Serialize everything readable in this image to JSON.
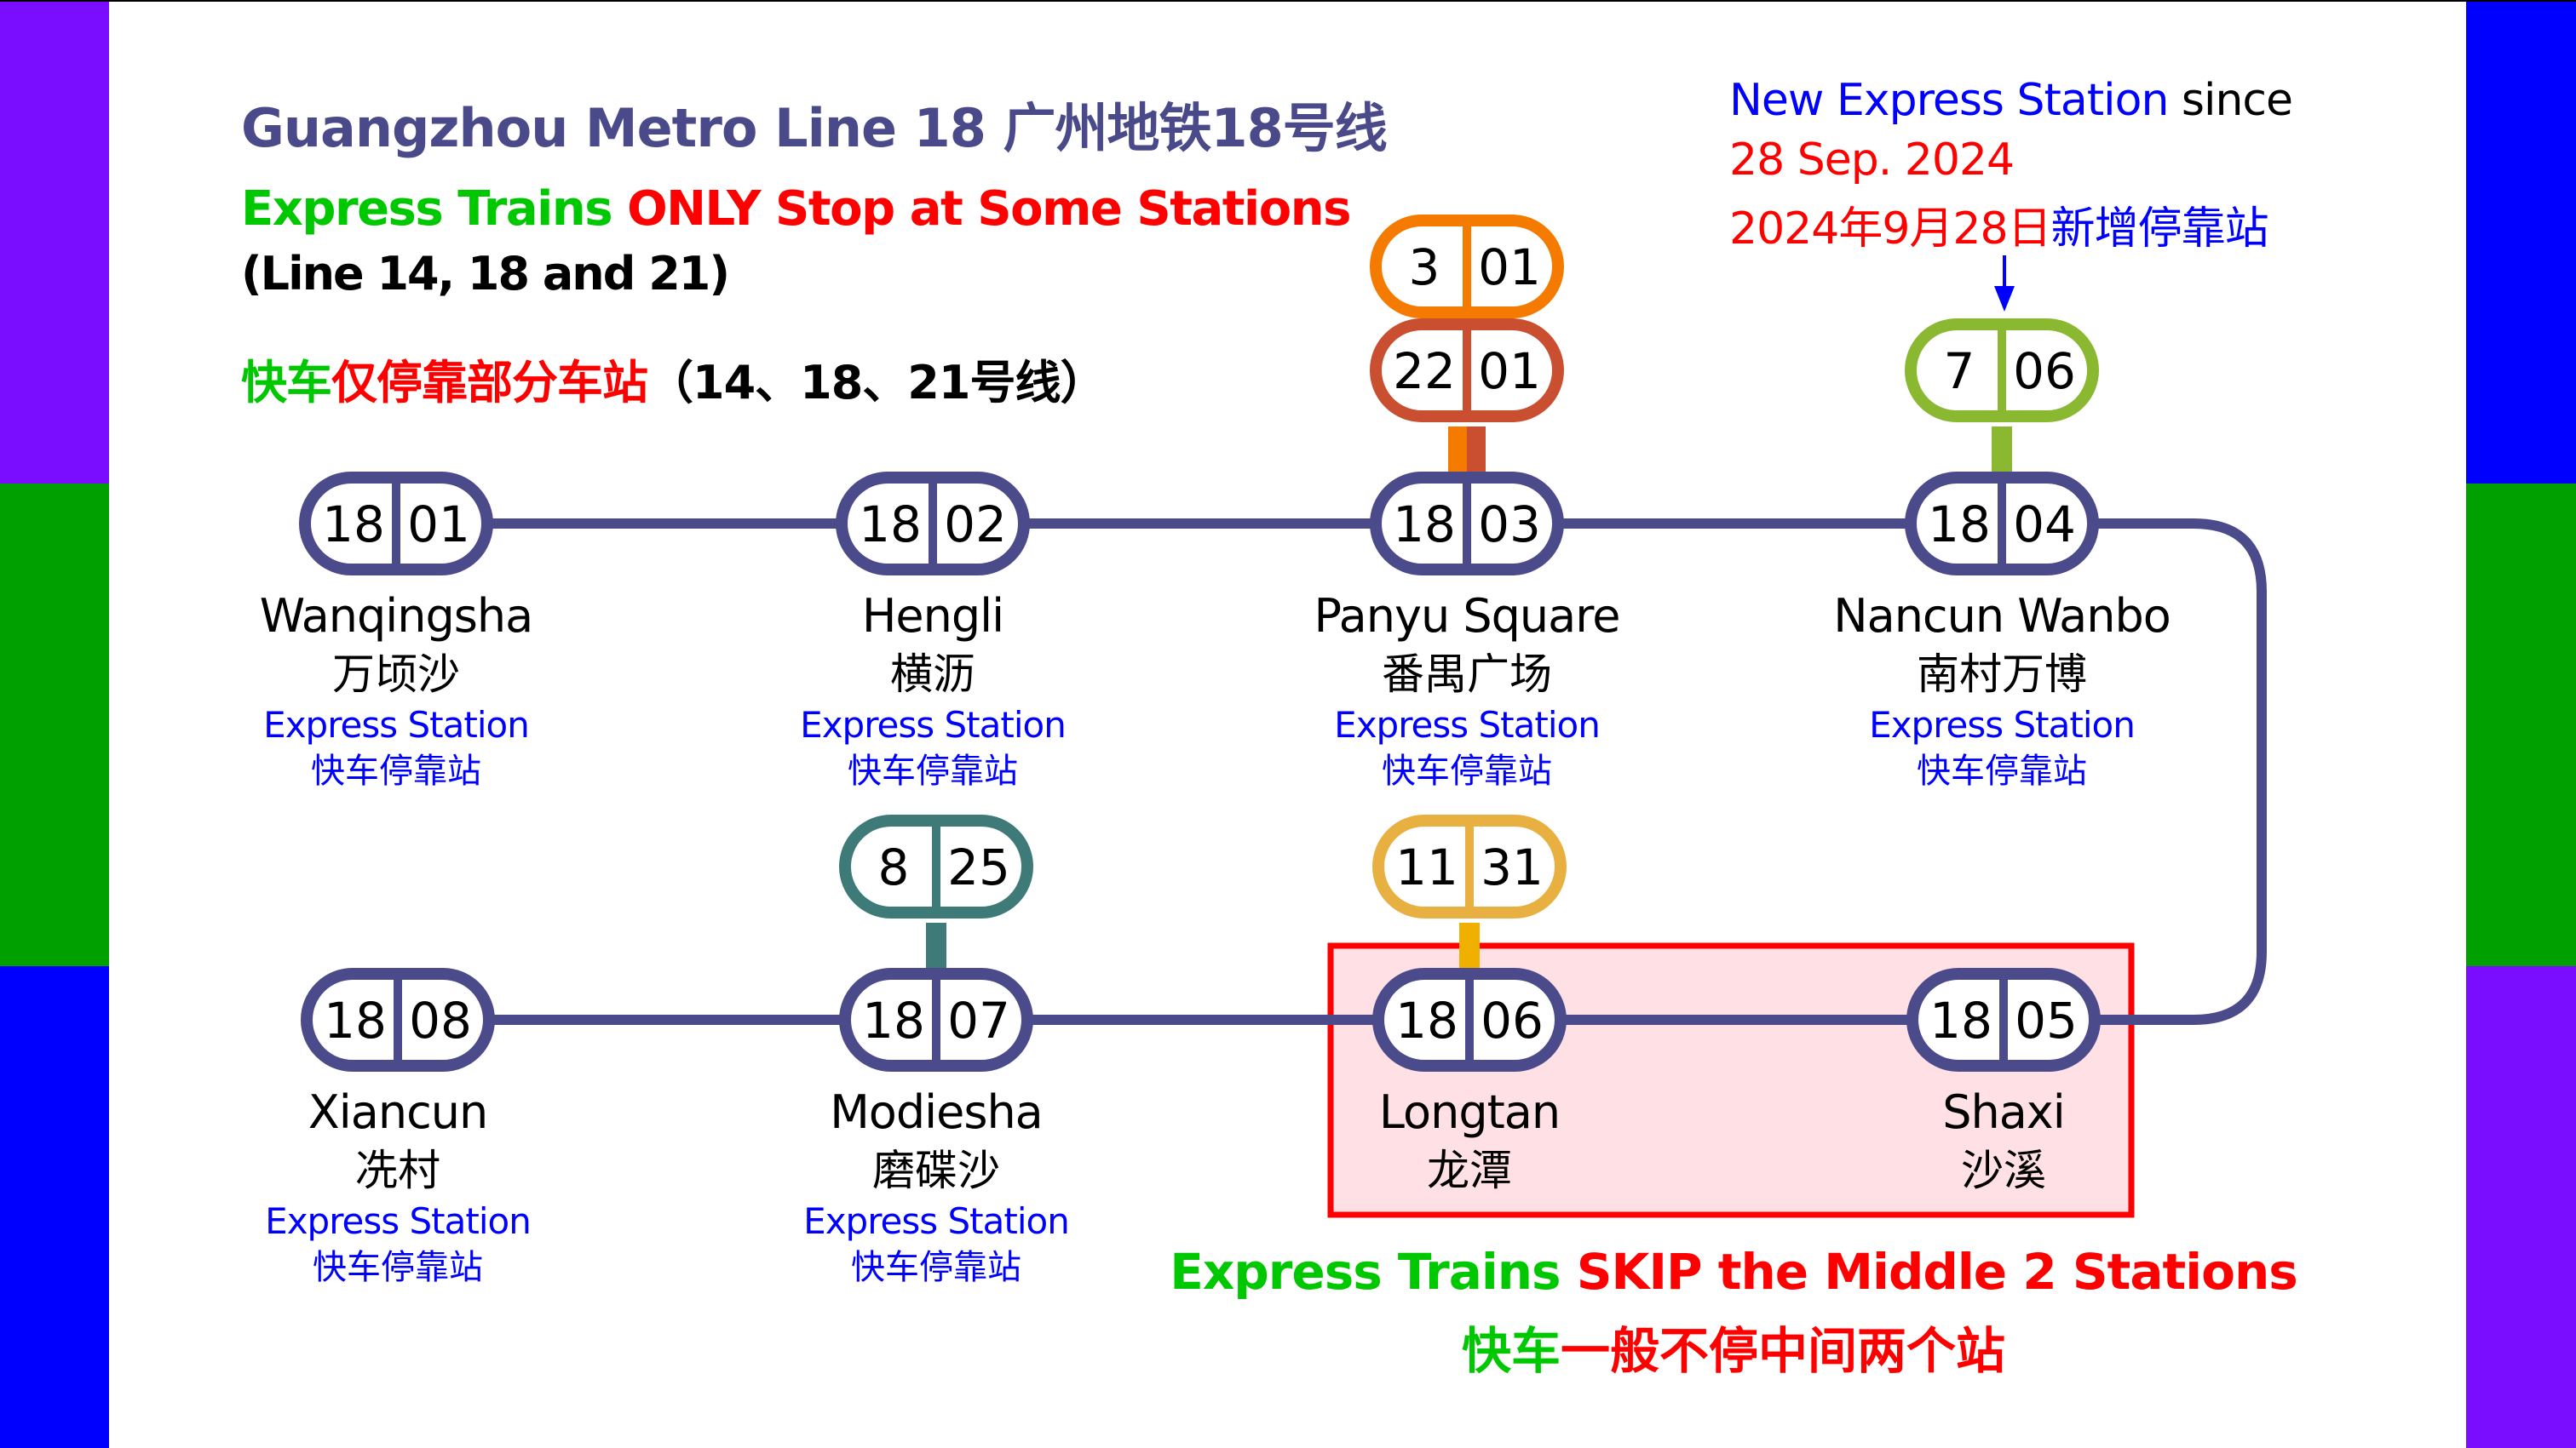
{
  "colors": {
    "line18": "#4b4a8a",
    "line3": "#f57a00",
    "line22": "#c94f30",
    "line7": "#8ab830",
    "line8": "#3d7a78",
    "line11": "#e8b040",
    "line11_connector": "#f0b000",
    "skip_box_border": "#ff0000",
    "skip_box_fill": "#ffe0e4",
    "sidebar_purple": "#7a0cff",
    "sidebar_green": "#00a000",
    "sidebar_blue": "#0000ff"
  },
  "sidebars": {
    "left": [
      "#7a0cff",
      "#00a000",
      "#0000ff"
    ],
    "right": [
      "#0000ff",
      "#00a000",
      "#7a0cff"
    ]
  },
  "header": {
    "title": "Guangzhou Metro Line 18 广州地铁18号线",
    "subtitle_en_green": "Express Trains ",
    "subtitle_en_red": "ONLY Stop at Some Stations",
    "subtitle_lines": "(Line 14, 18 and 21)",
    "subtitle_zh_green": "快车",
    "subtitle_zh_red": "仅停靠部分车站",
    "subtitle_zh_black": "（14、18、21号线）"
  },
  "new_station_note": {
    "line1_blue": "New Express Station",
    "line1_black": " since",
    "line2_red": "28 Sep. 2024",
    "line3_red": "2024年9月28日",
    "line3_blue": "新增停靠站",
    "arrow_icon": "arrow-down-icon"
  },
  "stations": [
    {
      "line": "18",
      "code": "01",
      "name_en": "Wanqingsha",
      "name_zh": "万顷沙",
      "express": true,
      "express_en": "Express Station",
      "express_zh": "快车停靠站",
      "transfers": []
    },
    {
      "line": "18",
      "code": "02",
      "name_en": "Hengli",
      "name_zh": "横沥",
      "express": true,
      "express_en": "Express Station",
      "express_zh": "快车停靠站",
      "transfers": []
    },
    {
      "line": "18",
      "code": "03",
      "name_en": "Panyu Square",
      "name_zh": "番禺广场",
      "express": true,
      "express_en": "Express Station",
      "express_zh": "快车停靠站",
      "transfers": [
        {
          "line": "22",
          "code": "01",
          "color": "#c94f30"
        },
        {
          "line": "3",
          "code": "01",
          "color": "#f57a00"
        }
      ]
    },
    {
      "line": "18",
      "code": "04",
      "name_en": "Nancun Wanbo",
      "name_zh": "南村万博",
      "express": true,
      "express_en": "Express Station",
      "express_zh": "快车停靠站",
      "transfers": [
        {
          "line": "7",
          "code": "06",
          "color": "#8ab830"
        }
      ]
    },
    {
      "line": "18",
      "code": "05",
      "name_en": "Shaxi",
      "name_zh": "沙溪",
      "express": false,
      "transfers": []
    },
    {
      "line": "18",
      "code": "06",
      "name_en": "Longtan",
      "name_zh": "龙潭",
      "express": false,
      "transfers": [
        {
          "line": "11",
          "code": "31",
          "color": "#e8b040"
        }
      ]
    },
    {
      "line": "18",
      "code": "07",
      "name_en": "Modiesha",
      "name_zh": "磨碟沙",
      "express": true,
      "express_en": "Express Station",
      "express_zh": "快车停靠站",
      "transfers": [
        {
          "line": "8",
          "code": "25",
          "color": "#3d7a78"
        }
      ]
    },
    {
      "line": "18",
      "code": "08",
      "name_en": "Xiancun",
      "name_zh": "冼村",
      "express": true,
      "express_en": "Express Station",
      "express_zh": "快车停靠站",
      "transfers": []
    }
  ],
  "skip_note": {
    "en_green": "Express Trains ",
    "en_red": "SKIP the Middle 2 Stations",
    "zh_green": "快车",
    "zh_red": "一般不停中间两个站"
  }
}
